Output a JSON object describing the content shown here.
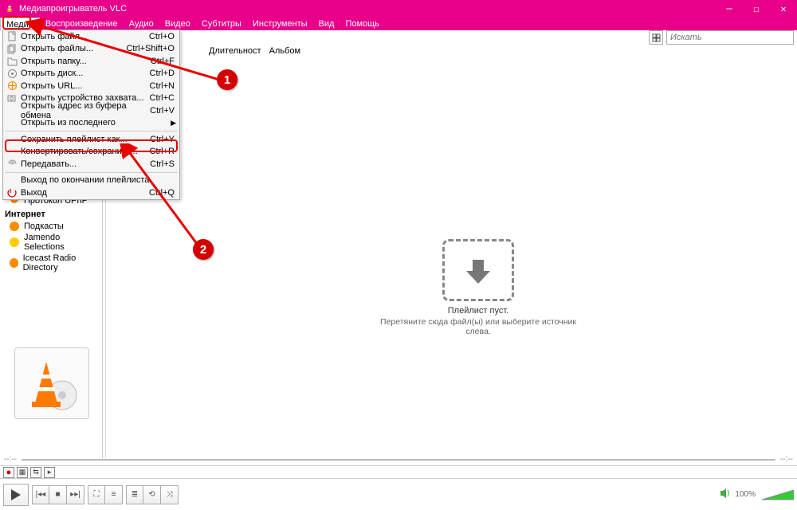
{
  "title": "Медиапроигрыватель VLC",
  "menubar": [
    "Медиа",
    "Воспроизведение",
    "Аудио",
    "Видео",
    "Субтитры",
    "Инструменты",
    "Вид",
    "Помощь"
  ],
  "dropdown": {
    "items": [
      {
        "icon": "file",
        "label": "Открыть файл...",
        "shortcut": "Ctrl+O"
      },
      {
        "icon": "files",
        "label": "Открыть файлы...",
        "shortcut": "Ctrl+Shift+O"
      },
      {
        "icon": "folder",
        "label": "Открыть папку...",
        "shortcut": "Ctrl+F"
      },
      {
        "icon": "disc",
        "label": "Открыть диск...",
        "shortcut": "Ctrl+D"
      },
      {
        "icon": "net",
        "label": "Открыть URL...",
        "shortcut": "Ctrl+N"
      },
      {
        "icon": "capture",
        "label": "Открыть устройство захвата...",
        "shortcut": "Ctrl+C"
      },
      {
        "icon": "",
        "label": "Открыть адрес из буфера обмена",
        "shortcut": "Ctrl+V"
      },
      {
        "icon": "",
        "label": "Открыть из последнего",
        "shortcut": "",
        "submenu": true
      }
    ],
    "items2": [
      {
        "icon": "",
        "label": "Сохранить плейлист как...",
        "shortcut": "Ctrl+Y"
      },
      {
        "icon": "",
        "label": "Конвертировать/сохранить...",
        "shortcut": "Ctrl+R"
      },
      {
        "icon": "stream",
        "label": "Передавать...",
        "shortcut": "Ctrl+S"
      }
    ],
    "items3": [
      {
        "icon": "",
        "label": "Выход по окончании плейлиста",
        "shortcut": ""
      },
      {
        "icon": "quit",
        "label": "Выход",
        "shortcut": "Ctrl+Q"
      }
    ]
  },
  "toolbar": {
    "search_placeholder": "Искать"
  },
  "columns": [
    "Длительност",
    "Альбом"
  ],
  "sidebar": {
    "upnp": "Протокол UPnP",
    "group": "Интернет",
    "items": [
      {
        "dot": "#ff8c00",
        "label": "Подкасты"
      },
      {
        "dot": "#ffcc00",
        "label": "Jamendo Selections"
      },
      {
        "dot": "#ff8c00",
        "label": "Icecast Radio Directory"
      }
    ]
  },
  "empty": {
    "line1": "Плейлист пуст.",
    "line2": "Перетяните сюда файл(ы) или выберите источник слева."
  },
  "time": {
    "left": "--:--",
    "right": "--:--"
  },
  "volume": "100%",
  "annotations": {
    "badge1": "1",
    "badge2": "2"
  }
}
